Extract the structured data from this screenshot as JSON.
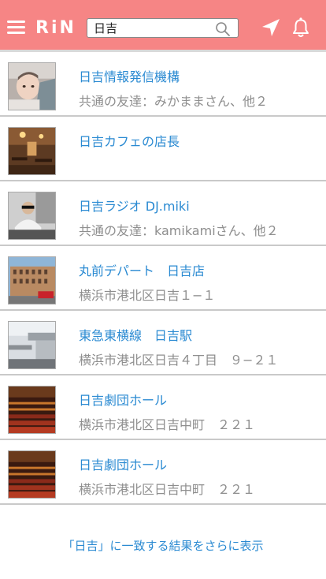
{
  "header": {
    "logo": "RiN",
    "search_value": "日吉",
    "menu_icon": "hamburger-menu-icon",
    "search_icon": "search-icon",
    "location_icon": "location-arrow-icon",
    "notification_icon": "bell-icon",
    "background_color": "#f68585"
  },
  "results": [
    {
      "title": "日吉情報発信機構",
      "subtitle": "共通の友達：みかままさん、他２"
    },
    {
      "title": "日吉カフェの店長",
      "subtitle": ""
    },
    {
      "title": "日吉ラジオ DJ.miki",
      "subtitle": "共通の友達：kamikamiさん、他２"
    },
    {
      "title": "丸前デパート　日吉店",
      "subtitle": "横浜市港北区日吉１−１"
    },
    {
      "title": "東急東横線　日吉駅",
      "subtitle": "横浜市港北区日吉４丁目　９−２１"
    },
    {
      "title": "日吉劇団ホール",
      "subtitle": "横浜市港北区日吉中町　２２１"
    },
    {
      "title": "日吉劇団ホール",
      "subtitle": "横浜市港北区日吉中町　２２１"
    }
  ],
  "more_link": "「日吉」に一致する結果をさらに表示",
  "colors": {
    "link": "#2a8ad2",
    "subtext": "#8e8e8e"
  }
}
